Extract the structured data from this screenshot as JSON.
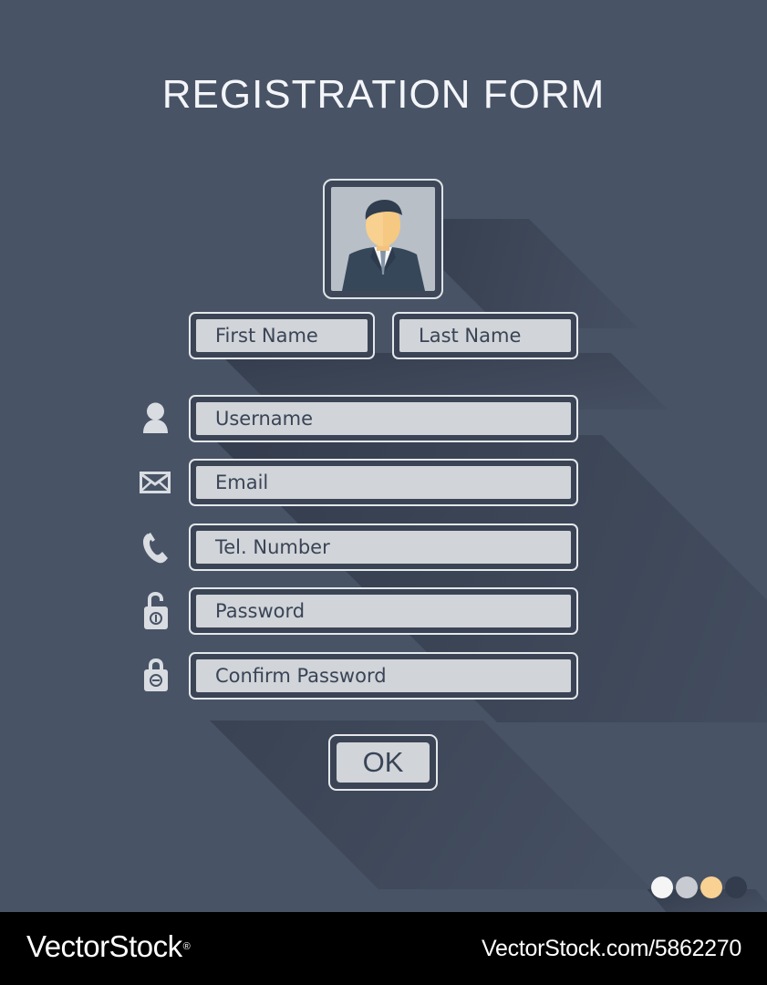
{
  "page": {
    "title": "REGISTRATION FORM",
    "background_color": "#485366"
  },
  "profile": {
    "avatar_icon": "user-avatar-icon"
  },
  "fields": {
    "first_name": "First Name",
    "last_name": "Last Name",
    "username": "Username",
    "email": "Email",
    "tel_number": "Tel. Number",
    "password": "Password",
    "confirm_password": "Confirm Password"
  },
  "field_icons": {
    "username": "user-icon",
    "email": "envelope-icon",
    "tel_number": "phone-icon",
    "password": "unlocked-padlock-icon",
    "confirm_password": "locked-padlock-icon"
  },
  "actions": {
    "ok_label": "OK"
  },
  "swatches": [
    {
      "name": "white-swatch",
      "color": "#f5f5f6"
    },
    {
      "name": "light-gray-swatch",
      "color": "#c8ccd2"
    },
    {
      "name": "peach-swatch",
      "color": "#f8d193"
    },
    {
      "name": "dark-slate-swatch",
      "color": "#323c4c"
    }
  ],
  "footer": {
    "brand": "VectorStock",
    "trademark": "®",
    "image_id": "VectorStock.com/5862270"
  }
}
